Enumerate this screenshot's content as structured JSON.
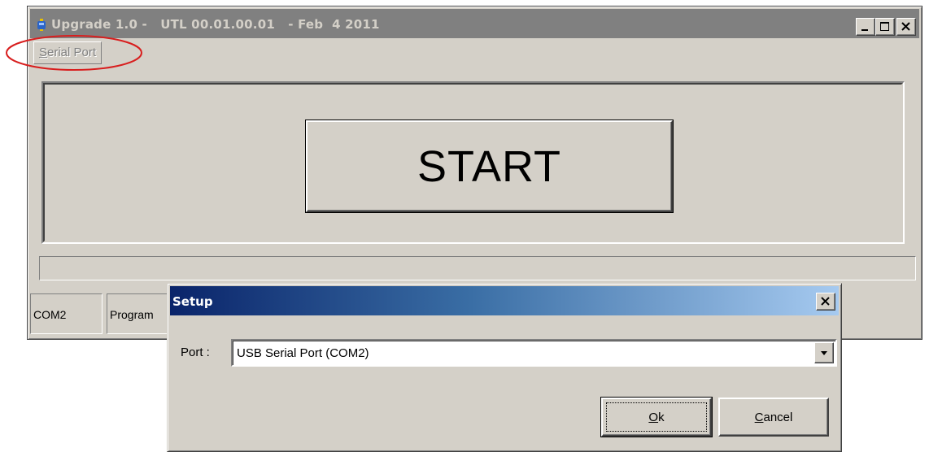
{
  "main_window": {
    "title": "Upgrade 1.0 -   UTL 00.01.00.01   - Feb  4 2011",
    "menu": {
      "serial_port_mnemonic": "S",
      "serial_port_rest": "erial Port"
    },
    "start_label": "START",
    "progress": 0,
    "status": {
      "port": "COM2",
      "program": "Program"
    }
  },
  "setup_dialog": {
    "title": "Setup",
    "port_label": "Port :",
    "port_value": "USB Serial Port (COM2)",
    "ok": {
      "mnemonic": "O",
      "rest": "k"
    },
    "cancel": {
      "mnemonic": "C",
      "rest": "ancel"
    }
  },
  "colors": {
    "face": "#d4d0c8",
    "inactive_title": "#808080",
    "active_title_start": "#0a246a",
    "active_title_end": "#a6caf0",
    "annotation": "#d81e1e"
  },
  "icons": [
    "app-icon",
    "minimize-icon",
    "maximize-icon",
    "close-icon",
    "dropdown-arrow-icon"
  ]
}
